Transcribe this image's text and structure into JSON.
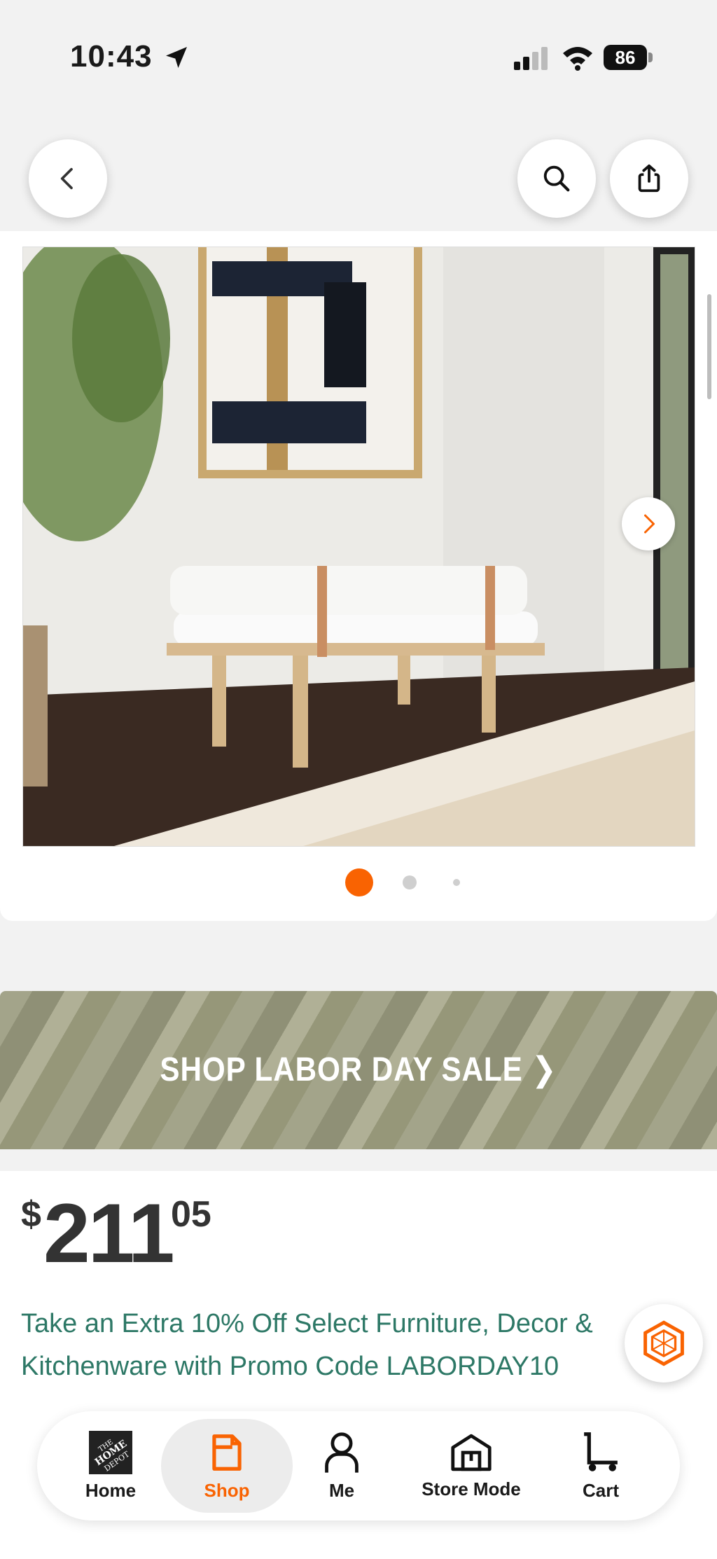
{
  "status_bar": {
    "time": "10:43",
    "battery": "86"
  },
  "banner": {
    "label": "SHOP LABOR DAY SALE ❯"
  },
  "price": {
    "currency": "$",
    "dollars": "211",
    "cents": "05"
  },
  "promo": {
    "text": "Take an Extra 10% Off Select Furniture, Decor & Kitchenware with Promo Code LABORDAY10"
  },
  "carousel": {
    "active_index": 0,
    "count": 3
  },
  "nav": {
    "items": [
      {
        "label": "Home"
      },
      {
        "label": "Shop"
      },
      {
        "label": "Me"
      },
      {
        "label": "Store Mode"
      },
      {
        "label": "Cart"
      }
    ]
  },
  "colors": {
    "accent": "#f96302",
    "promo": "#2d7866",
    "banner": "#a3a48a"
  }
}
